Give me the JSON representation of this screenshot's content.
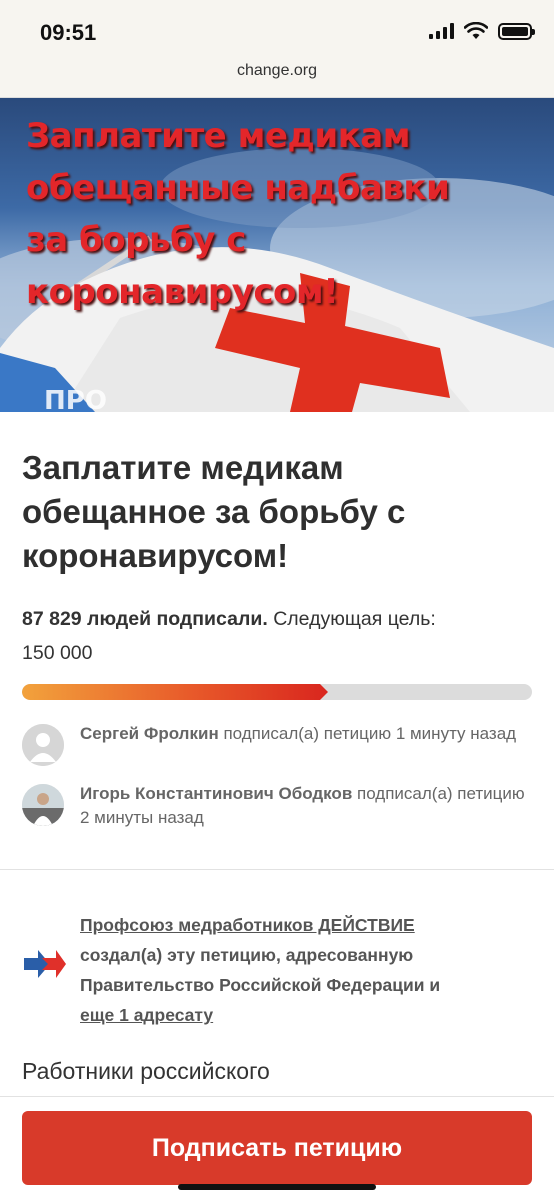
{
  "status_bar": {
    "time": "09:51"
  },
  "browser": {
    "url": "change.org"
  },
  "hero": {
    "overlay_text": "Заплатите медикам\nобещанные надбавки\nза борьбу с коронавирусом!",
    "flag_letters": "ПРО"
  },
  "petition": {
    "title": "Заплатите медикам обещанное за борьбу с коронавирусом!",
    "signed_count": "87 829 людей подписали.",
    "next_goal_label": "Следующая цель:",
    "next_goal_value": "150 000",
    "progress_fraction": 0.6
  },
  "recent_signers": [
    {
      "name": "Сергей Фролкин",
      "action": "подписал(а) петицию 1 минуту назад"
    },
    {
      "name": "Игорь Константинович Ободков",
      "action": "подписал(а) петицию 2 минуты назад"
    }
  ],
  "creator": {
    "org_name": "Профсоюз медработников ДЕЙСТВИЕ",
    "created_text": "создал(а) эту петицию, адресованную",
    "addressee": "Правительство Российской Федерации",
    "and": "и",
    "more_link": "еще 1 адресату"
  },
  "body": {
    "first_line": "Работники российского"
  },
  "actions": {
    "sign_label": "Подписать петицию"
  },
  "colors": {
    "accent": "#d83a2a",
    "progress_start": "#f2a23c",
    "progress_end": "#d9261e"
  }
}
